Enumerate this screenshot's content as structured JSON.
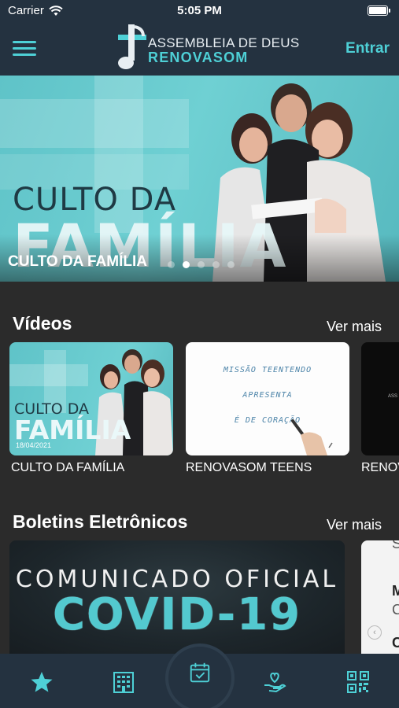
{
  "status_bar": {
    "carrier": "Carrier",
    "time": "5:05 PM"
  },
  "header": {
    "logo_line1": "ASSEMBLEIA DE DEUS",
    "logo_line2": "RENOVASOM",
    "login_label": "Entrar"
  },
  "hero": {
    "banner_line1": "CULTO DA",
    "banner_line2": "FAMÍLIA",
    "caption": "CULTO DA FAMÍLIA",
    "slide_count": 5,
    "active_slide": 1
  },
  "videos": {
    "title": "Vídeos",
    "see_more": "Ver mais",
    "items": [
      {
        "label": "CULTO DA FAMÍLIA",
        "thumb_line1": "CULTO DA",
        "thumb_line2": "FAMÍLIA",
        "date": "18/04/2021"
      },
      {
        "label": "RENOVASOM TEENS",
        "thumb_lines": [
          "MISSÃO TEENTENDO",
          "APRESENTA",
          "É DE CORAÇÃO"
        ]
      },
      {
        "label": "RENOV",
        "thumb_text": "ASS"
      }
    ]
  },
  "bulletins": {
    "title": "Boletins Eletrônicos",
    "see_more": "Ver mais",
    "items": [
      {
        "line1": "COMUNICADO OFICIAL",
        "line2": "COVID-19"
      },
      {
        "lines": [
          "S",
          "M",
          "C",
          "C"
        ]
      }
    ]
  },
  "tabbar": {
    "items": [
      {
        "icon": "star-icon"
      },
      {
        "icon": "building-icon"
      },
      {
        "icon": "calendar-check-icon"
      },
      {
        "icon": "hand-heart-icon"
      },
      {
        "icon": "qr-code-icon"
      }
    ]
  },
  "colors": {
    "accent": "#4ed0d6",
    "header_bg": "#243240",
    "page_bg": "#2b2b2b",
    "teal_art": "#6fd0d3"
  }
}
